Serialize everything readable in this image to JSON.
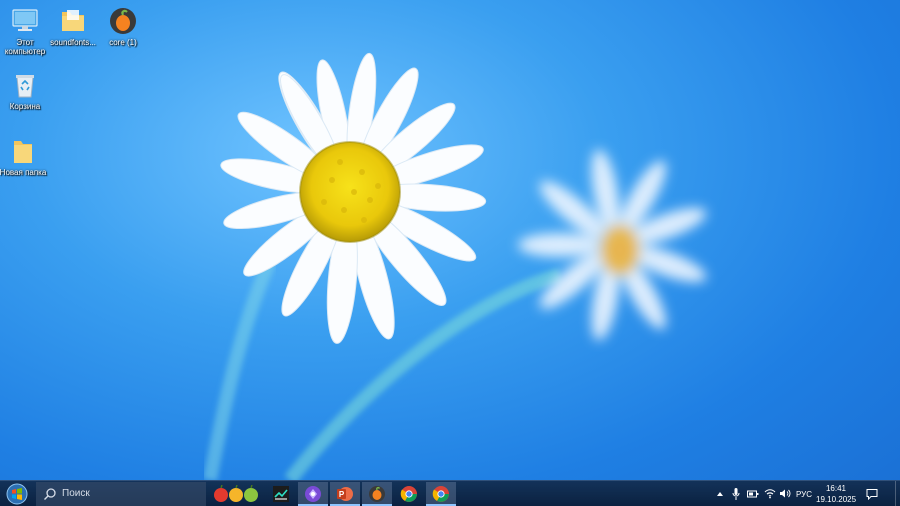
{
  "desktop": {
    "icons": [
      {
        "label": "Этот компьютер",
        "icon": "computer-icon"
      },
      {
        "label": "soundfonts...",
        "icon": "folder-icon"
      },
      {
        "label": "core (1)",
        "icon": "fl-studio-icon"
      },
      {
        "label": "Корзина",
        "icon": "recycle-bin-icon"
      },
      {
        "label": "Новая папка",
        "icon": "folder-icon"
      }
    ]
  },
  "taskbar": {
    "search_placeholder": "Поиск",
    "apps": [
      {
        "name": "fruits-app",
        "icon": "fruits-icon",
        "active": false
      },
      {
        "name": "dark-app",
        "icon": "graph-app-icon",
        "active": false
      },
      {
        "name": "purple-app",
        "icon": "purple-app-icon",
        "active": true
      },
      {
        "name": "powerpoint",
        "icon": "powerpoint-icon",
        "active": true
      },
      {
        "name": "fl-studio",
        "icon": "fl-studio-icon",
        "active": true
      },
      {
        "name": "chrome",
        "icon": "chrome-icon",
        "active": false
      },
      {
        "name": "chrome-2",
        "icon": "chrome-icon",
        "active": true
      }
    ],
    "tray": {
      "language": "РУС",
      "time": "16:41",
      "date": "19.10.2025"
    }
  },
  "colors": {
    "accent": "#1f7fe3",
    "taskbar": "#122c4e"
  }
}
